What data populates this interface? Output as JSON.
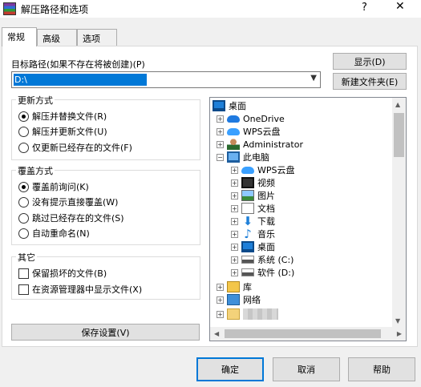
{
  "window": {
    "title": "解压路径和选项",
    "help": "?",
    "close": "✕"
  },
  "tabs": [
    {
      "label": "常规"
    },
    {
      "label": "高级"
    },
    {
      "label": "选项"
    }
  ],
  "path": {
    "label": "目标路径(如果不存在将被创建)(P)",
    "value": "D:\\"
  },
  "buttons": {
    "show": "显示(D)",
    "new_folder": "新建文件夹(E)",
    "save_settings": "保存设置(V)",
    "ok": "确定",
    "cancel": "取消",
    "help": "帮助"
  },
  "update_mode": {
    "title": "更新方式",
    "options": [
      {
        "label": "解压并替换文件(R)",
        "selected": true
      },
      {
        "label": "解压并更新文件(U)",
        "selected": false
      },
      {
        "label": "仅更新已经存在的文件(F)",
        "selected": false
      }
    ]
  },
  "overwrite_mode": {
    "title": "覆盖方式",
    "options": [
      {
        "label": "覆盖前询问(K)",
        "selected": true
      },
      {
        "label": "没有提示直接覆盖(W)",
        "selected": false
      },
      {
        "label": "跳过已经存在的文件(S)",
        "selected": false
      },
      {
        "label": "自动重命名(N)",
        "selected": false
      }
    ]
  },
  "misc": {
    "title": "其它",
    "options": [
      {
        "label": "保留损坏的文件(B)",
        "checked": false
      },
      {
        "label": "在资源管理器中显示文件(X)",
        "checked": false
      }
    ]
  },
  "tree": {
    "items": [
      {
        "label": "桌面",
        "icon": "desktop-icon"
      },
      {
        "label": "OneDrive",
        "icon": "cloud-icon"
      },
      {
        "label": "WPS云盘",
        "icon": "wps-cloud-icon"
      },
      {
        "label": "Administrator",
        "icon": "user-icon"
      },
      {
        "label": "此电脑",
        "icon": "computer-icon"
      },
      {
        "label": "WPS云盘",
        "icon": "wps-cloud-icon"
      },
      {
        "label": "视频",
        "icon": "video-icon"
      },
      {
        "label": "图片",
        "icon": "pictures-icon"
      },
      {
        "label": "文档",
        "icon": "documents-icon"
      },
      {
        "label": "下载",
        "icon": "download-icon"
      },
      {
        "label": "音乐",
        "icon": "music-icon"
      },
      {
        "label": "桌面",
        "icon": "desktop-icon"
      },
      {
        "label": "系统 (C:)",
        "icon": "drive-icon"
      },
      {
        "label": "软件 (D:)",
        "icon": "drive-icon"
      },
      {
        "label": "库",
        "icon": "library-icon"
      },
      {
        "label": "网络",
        "icon": "network-icon"
      }
    ]
  }
}
